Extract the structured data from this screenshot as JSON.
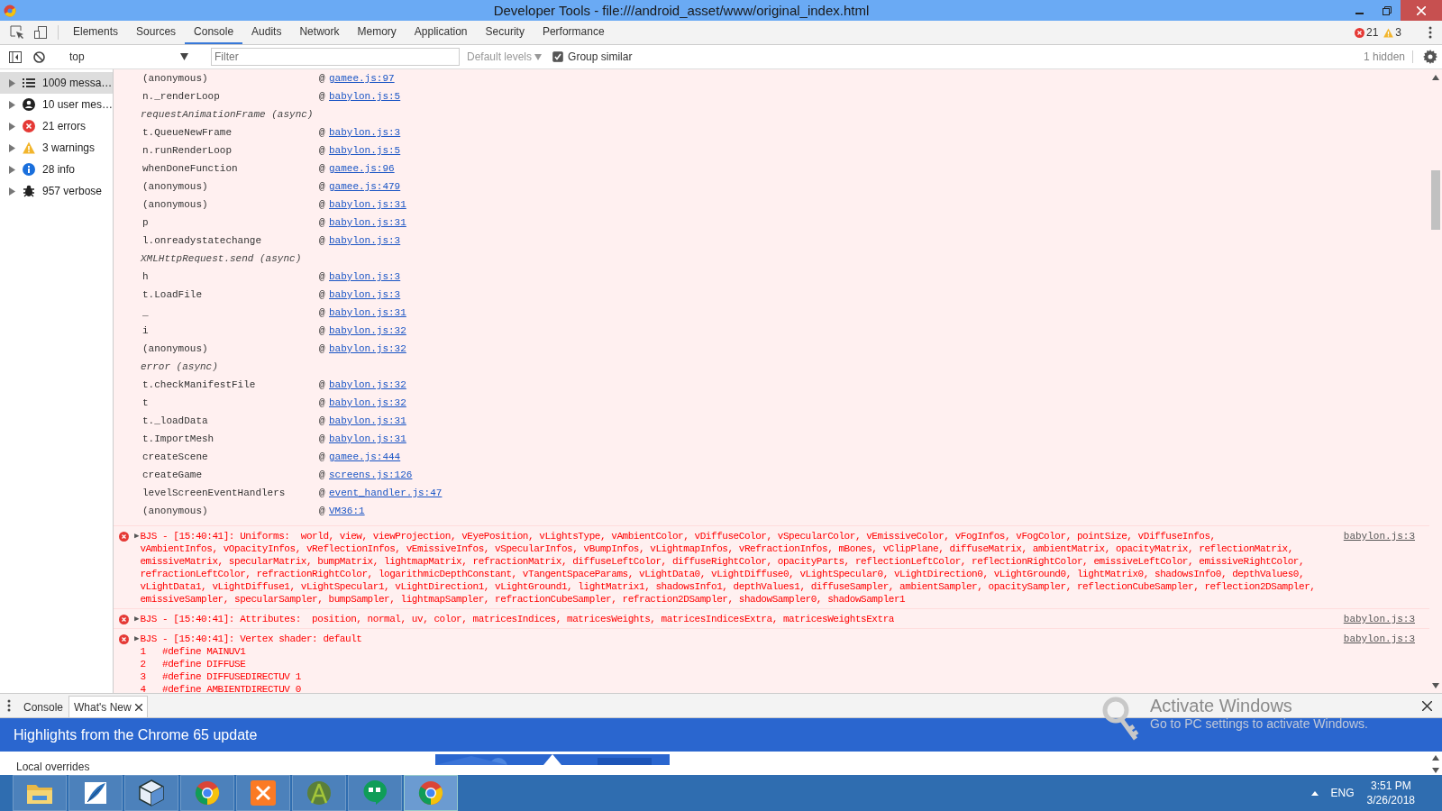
{
  "window": {
    "title": "Developer Tools - file:///android_asset/www/original_index.html"
  },
  "tabs": [
    {
      "label": "Elements",
      "selected": false
    },
    {
      "label": "Sources",
      "selected": false
    },
    {
      "label": "Console",
      "selected": true
    },
    {
      "label": "Audits",
      "selected": false
    },
    {
      "label": "Network",
      "selected": false
    },
    {
      "label": "Memory",
      "selected": false
    },
    {
      "label": "Application",
      "selected": false
    },
    {
      "label": "Security",
      "selected": false
    },
    {
      "label": "Performance",
      "selected": false
    }
  ],
  "counters": [
    {
      "kind": "error",
      "count": "21"
    },
    {
      "kind": "warning",
      "count": "3"
    }
  ],
  "toolbar": {
    "context": "top",
    "filter": {
      "placeholder": "Filter"
    },
    "levels": "Default levels",
    "group_similar": {
      "label": "Group similar",
      "checked": true
    },
    "hidden": "1 hidden"
  },
  "sidebar": {
    "items": [
      {
        "kind": "messages",
        "label": "1009 messa…",
        "selected": true
      },
      {
        "kind": "user",
        "label": "10 user mes…",
        "selected": false
      },
      {
        "kind": "error",
        "label": "21 errors",
        "selected": false
      },
      {
        "kind": "warning",
        "label": "3 warnings",
        "selected": false
      },
      {
        "kind": "info",
        "label": "28 info",
        "selected": false
      },
      {
        "kind": "verbose",
        "label": "957 verbose",
        "selected": false
      }
    ]
  },
  "stack": [
    {
      "kind": "frame",
      "function": "(anonymous)",
      "prefix": "@",
      "link": "gamee.js:97"
    },
    {
      "kind": "frame",
      "function": "n._renderLoop",
      "prefix": "@",
      "link": "babylon.js:5"
    },
    {
      "kind": "async",
      "label": "requestAnimationFrame (async)"
    },
    {
      "kind": "frame",
      "function": "t.QueueNewFrame",
      "prefix": "@",
      "link": "babylon.js:3"
    },
    {
      "kind": "frame",
      "function": "n.runRenderLoop",
      "prefix": "@",
      "link": "babylon.js:5"
    },
    {
      "kind": "frame",
      "function": "whenDoneFunction",
      "prefix": "@",
      "link": "gamee.js:96"
    },
    {
      "kind": "frame",
      "function": "(anonymous)",
      "prefix": "@",
      "link": "gamee.js:479"
    },
    {
      "kind": "frame",
      "function": "(anonymous)",
      "prefix": "@",
      "link": "babylon.js:31"
    },
    {
      "kind": "frame",
      "function": "p",
      "prefix": "@",
      "link": "babylon.js:31"
    },
    {
      "kind": "frame",
      "function": "l.onreadystatechange",
      "prefix": "@",
      "link": "babylon.js:3"
    },
    {
      "kind": "async",
      "label": "XMLHttpRequest.send (async)"
    },
    {
      "kind": "frame",
      "function": "h",
      "prefix": "@",
      "link": "babylon.js:3"
    },
    {
      "kind": "frame",
      "function": "t.LoadFile",
      "prefix": "@",
      "link": "babylon.js:3"
    },
    {
      "kind": "frame",
      "function": "_",
      "prefix": "@",
      "link": "babylon.js:31"
    },
    {
      "kind": "frame",
      "function": "i",
      "prefix": "@",
      "link": "babylon.js:32"
    },
    {
      "kind": "frame",
      "function": "(anonymous)",
      "prefix": "@",
      "link": "babylon.js:32"
    },
    {
      "kind": "async",
      "label": "error (async)"
    },
    {
      "kind": "frame",
      "function": "t.checkManifestFile",
      "prefix": "@",
      "link": "babylon.js:32"
    },
    {
      "kind": "frame",
      "function": "t",
      "prefix": "@",
      "link": "babylon.js:32"
    },
    {
      "kind": "frame",
      "function": "t._loadData",
      "prefix": "@",
      "link": "babylon.js:31"
    },
    {
      "kind": "frame",
      "function": "t.ImportMesh",
      "prefix": "@",
      "link": "babylon.js:31"
    },
    {
      "kind": "frame",
      "function": "createScene",
      "prefix": "@",
      "link": "gamee.js:444"
    },
    {
      "kind": "frame",
      "function": "createGame",
      "prefix": "@",
      "link": "screens.js:126"
    },
    {
      "kind": "frame",
      "function": "levelScreenEventHandlers",
      "prefix": "@",
      "link": "event_handler.js:47"
    },
    {
      "kind": "frame",
      "function": "(anonymous)",
      "prefix": "@",
      "link": "VM36:1"
    }
  ],
  "messages": [
    {
      "kind": "error",
      "expander": "▶",
      "source": "babylon.js:3",
      "lines": [
        "BJS - [15:40:41]: Uniforms:  world, view, viewProjection, vEyePosition, vLightsType, vAmbientColor, vDiffuseColor, vSpecularColor, vEmissiveColor, vFogInfos, vFogColor, pointSize, vDiffuseInfos,",
        "vAmbientInfos, vOpacityInfos, vReflectionInfos, vEmissiveInfos, vSpecularInfos, vBumpInfos, vLightmapInfos, vRefractionInfos, mBones, vClipPlane, diffuseMatrix, ambientMatrix, opacityMatrix, reflectionMatrix,",
        "emissiveMatrix, specularMatrix, bumpMatrix, lightmapMatrix, refractionMatrix, diffuseLeftColor, diffuseRightColor, opacityParts, reflectionLeftColor, reflectionRightColor, emissiveLeftColor, emissiveRightColor,",
        "refractionLeftColor, refractionRightColor, logarithmicDepthConstant, vTangentSpaceParams, vLightData0, vLightDiffuse0, vLightSpecular0, vLightDirection0, vLightGround0, lightMatrix0, shadowsInfo0, depthValues0,",
        "vLightData1, vLightDiffuse1, vLightSpecular1, vLightDirection1, vLightGround1, lightMatrix1, shadowsInfo1, depthValues1, diffuseSampler, ambientSampler, opacitySampler, reflectionCubeSampler, reflection2DSampler,",
        "emissiveSampler, specularSampler, bumpSampler, lightmapSampler, refractionCubeSampler, refraction2DSampler, shadowSampler0, shadowSampler1"
      ]
    },
    {
      "kind": "error",
      "expander": "▶",
      "source": "babylon.js:3",
      "lines": [
        "BJS - [15:40:41]: Attributes:  position, normal, uv, color, matricesIndices, matricesWeights, matricesIndicesExtra, matricesWeightsExtra"
      ]
    },
    {
      "kind": "error",
      "expander": "▶",
      "source": "babylon.js:3",
      "lines": [
        "BJS - [15:40:41]: Vertex shader: default",
        "1   #define MAINUV1",
        "2   #define DIFFUSE",
        "3   #define DIFFUSEDIRECTUV 1",
        "4   #define AMBIENTDIRECTUV 0"
      ]
    }
  ],
  "drawer": {
    "tabs": [
      {
        "label": "Console",
        "selected": false,
        "closable": false
      },
      {
        "label": "What's New",
        "selected": true,
        "closable": true
      }
    ],
    "banner": "Highlights from the Chrome 65 update",
    "section": "Local overrides"
  },
  "activation_notice": {
    "title": "Activate Windows",
    "subtitle": "Go to PC settings to activate Windows."
  },
  "taskbar": {
    "apps": [
      {
        "kind": "folder",
        "active": false
      },
      {
        "kind": "feather",
        "active": false
      },
      {
        "kind": "cube",
        "active": false
      },
      {
        "kind": "chrome",
        "active": false
      },
      {
        "kind": "xampp",
        "active": false
      },
      {
        "kind": "android",
        "active": false
      },
      {
        "kind": "chat",
        "active": false
      },
      {
        "kind": "chrome",
        "active": true
      }
    ],
    "language": "ENG",
    "time": "3:51 PM",
    "date": "3/26/2018"
  }
}
